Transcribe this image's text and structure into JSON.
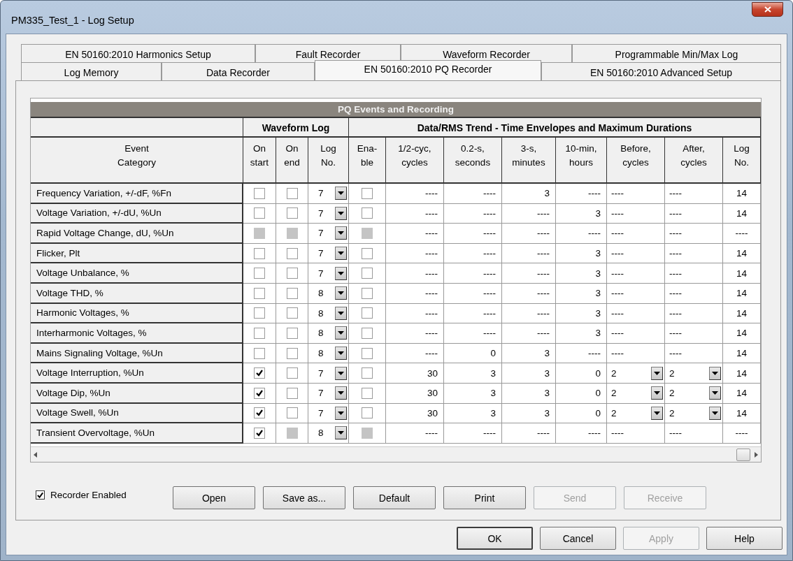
{
  "window": {
    "title": "PM335_Test_1 - Log Setup"
  },
  "tabs": {
    "back_row": [
      {
        "label": "EN 50160:2010 Harmonics Setup",
        "selected": false
      },
      {
        "label": "Fault Recorder",
        "selected": false
      },
      {
        "label": "Waveform Recorder",
        "selected": false
      },
      {
        "label": "Programmable Min/Max Log",
        "selected": false
      }
    ],
    "front_row": [
      {
        "label": "Log Memory",
        "selected": false
      },
      {
        "label": "Data Recorder",
        "selected": false
      },
      {
        "label": "EN 50160:2010 PQ Recorder",
        "selected": true
      },
      {
        "label": "EN 50160:2010 Advanced Setup",
        "selected": false
      }
    ]
  },
  "table": {
    "title": "PQ Events and Recording",
    "groups": [
      "Waveform Log",
      "Data/RMS Trend - Time Envelopes and Maximum Durations"
    ],
    "columns": [
      "Event\nCategory",
      "On\nstart",
      "On\nend",
      "Log\nNo.",
      "Ena-\nble",
      "1/2-cyc,\ncycles",
      "0.2-s,\nseconds",
      "3-s,\nminutes",
      "10-min,\nhours",
      "Before,\ncycles",
      "After,\ncycles",
      "Log\nNo."
    ],
    "rows": [
      {
        "category": "Frequency Variation, +/-dF, %Fn",
        "on_start": {
          "checked": false,
          "disabled": false
        },
        "on_end": {
          "checked": false,
          "disabled": false
        },
        "log_no": "7",
        "enable": {
          "checked": false,
          "disabled": false
        },
        "half_cycle": "----",
        "s02": "----",
        "s3": "3",
        "min10": "----",
        "before": {
          "kind": "text",
          "value": "----"
        },
        "after": {
          "kind": "text",
          "value": "----"
        },
        "trend_log_no": "14"
      },
      {
        "category": "Voltage Variation, +/-dU, %Un",
        "on_start": {
          "checked": false,
          "disabled": false
        },
        "on_end": {
          "checked": false,
          "disabled": false
        },
        "log_no": "7",
        "enable": {
          "checked": false,
          "disabled": false
        },
        "half_cycle": "----",
        "s02": "----",
        "s3": "----",
        "min10": "3",
        "before": {
          "kind": "text",
          "value": "----"
        },
        "after": {
          "kind": "text",
          "value": "----"
        },
        "trend_log_no": "14"
      },
      {
        "category": "Rapid Voltage Change, dU, %Un",
        "on_start": {
          "checked": false,
          "disabled": true
        },
        "on_end": {
          "checked": false,
          "disabled": true
        },
        "log_no": "7",
        "enable": {
          "checked": false,
          "disabled": true
        },
        "half_cycle": "----",
        "s02": "----",
        "s3": "----",
        "min10": "----",
        "before": {
          "kind": "text",
          "value": "----"
        },
        "after": {
          "kind": "text",
          "value": "----"
        },
        "trend_log_no": "----"
      },
      {
        "category": "Flicker, Plt",
        "on_start": {
          "checked": false,
          "disabled": false
        },
        "on_end": {
          "checked": false,
          "disabled": false
        },
        "log_no": "7",
        "enable": {
          "checked": false,
          "disabled": false
        },
        "half_cycle": "----",
        "s02": "----",
        "s3": "----",
        "min10": "3",
        "before": {
          "kind": "text",
          "value": "----"
        },
        "after": {
          "kind": "text",
          "value": "----"
        },
        "trend_log_no": "14"
      },
      {
        "category": "Voltage Unbalance, %",
        "on_start": {
          "checked": false,
          "disabled": false
        },
        "on_end": {
          "checked": false,
          "disabled": false
        },
        "log_no": "7",
        "enable": {
          "checked": false,
          "disabled": false
        },
        "half_cycle": "----",
        "s02": "----",
        "s3": "----",
        "min10": "3",
        "before": {
          "kind": "text",
          "value": "----"
        },
        "after": {
          "kind": "text",
          "value": "----"
        },
        "trend_log_no": "14"
      },
      {
        "category": "Voltage THD, %",
        "on_start": {
          "checked": false,
          "disabled": false
        },
        "on_end": {
          "checked": false,
          "disabled": false
        },
        "log_no": "8",
        "enable": {
          "checked": false,
          "disabled": false
        },
        "half_cycle": "----",
        "s02": "----",
        "s3": "----",
        "min10": "3",
        "before": {
          "kind": "text",
          "value": "----"
        },
        "after": {
          "kind": "text",
          "value": "----"
        },
        "trend_log_no": "14"
      },
      {
        "category": "Harmonic Voltages, %",
        "on_start": {
          "checked": false,
          "disabled": false
        },
        "on_end": {
          "checked": false,
          "disabled": false
        },
        "log_no": "8",
        "enable": {
          "checked": false,
          "disabled": false
        },
        "half_cycle": "----",
        "s02": "----",
        "s3": "----",
        "min10": "3",
        "before": {
          "kind": "text",
          "value": "----"
        },
        "after": {
          "kind": "text",
          "value": "----"
        },
        "trend_log_no": "14"
      },
      {
        "category": "Interharmonic Voltages, %",
        "on_start": {
          "checked": false,
          "disabled": false
        },
        "on_end": {
          "checked": false,
          "disabled": false
        },
        "log_no": "8",
        "enable": {
          "checked": false,
          "disabled": false
        },
        "half_cycle": "----",
        "s02": "----",
        "s3": "----",
        "min10": "3",
        "before": {
          "kind": "text",
          "value": "----"
        },
        "after": {
          "kind": "text",
          "value": "----"
        },
        "trend_log_no": "14"
      },
      {
        "category": "Mains Signaling Voltage, %Un",
        "on_start": {
          "checked": false,
          "disabled": false
        },
        "on_end": {
          "checked": false,
          "disabled": false
        },
        "log_no": "8",
        "enable": {
          "checked": false,
          "disabled": false
        },
        "half_cycle": "----",
        "s02": "0",
        "s3": "3",
        "min10": "----",
        "before": {
          "kind": "text",
          "value": "----"
        },
        "after": {
          "kind": "text",
          "value": "----"
        },
        "trend_log_no": "14"
      },
      {
        "category": "Voltage Interruption, %Un",
        "on_start": {
          "checked": true,
          "disabled": false
        },
        "on_end": {
          "checked": false,
          "disabled": false
        },
        "log_no": "7",
        "enable": {
          "checked": false,
          "disabled": false
        },
        "half_cycle": "30",
        "s02": "3",
        "s3": "3",
        "min10": "0",
        "before": {
          "kind": "dropdown",
          "value": "2"
        },
        "after": {
          "kind": "dropdown",
          "value": "2"
        },
        "trend_log_no": "14"
      },
      {
        "category": "Voltage Dip, %Un",
        "on_start": {
          "checked": true,
          "disabled": false
        },
        "on_end": {
          "checked": false,
          "disabled": false
        },
        "log_no": "7",
        "enable": {
          "checked": false,
          "disabled": false
        },
        "half_cycle": "30",
        "s02": "3",
        "s3": "3",
        "min10": "0",
        "before": {
          "kind": "dropdown",
          "value": "2"
        },
        "after": {
          "kind": "dropdown",
          "value": "2"
        },
        "trend_log_no": "14"
      },
      {
        "category": "Voltage Swell, %Un",
        "on_start": {
          "checked": true,
          "disabled": false
        },
        "on_end": {
          "checked": false,
          "disabled": false
        },
        "log_no": "7",
        "enable": {
          "checked": false,
          "disabled": false
        },
        "half_cycle": "30",
        "s02": "3",
        "s3": "3",
        "min10": "0",
        "before": {
          "kind": "dropdown",
          "value": "2"
        },
        "after": {
          "kind": "dropdown",
          "value": "2"
        },
        "trend_log_no": "14"
      },
      {
        "category": "Transient Overvoltage, %Un",
        "on_start": {
          "checked": true,
          "disabled": false
        },
        "on_end": {
          "checked": false,
          "disabled": true
        },
        "log_no": "8",
        "enable": {
          "checked": false,
          "disabled": true
        },
        "half_cycle": "----",
        "s02": "----",
        "s3": "----",
        "min10": "----",
        "before": {
          "kind": "text",
          "value": "----"
        },
        "after": {
          "kind": "text",
          "value": "----"
        },
        "trend_log_no": "----"
      }
    ]
  },
  "recorder_enabled": {
    "label": "Recorder Enabled",
    "checked": true
  },
  "buttons": [
    {
      "label": "Open",
      "disabled": false
    },
    {
      "label": "Save as...",
      "disabled": false
    },
    {
      "label": "Default",
      "disabled": false
    },
    {
      "label": "Print",
      "disabled": false
    },
    {
      "label": "Send",
      "disabled": true
    },
    {
      "label": "Receive",
      "disabled": true
    }
  ],
  "dialog_buttons": [
    {
      "label": "OK",
      "disabled": false
    },
    {
      "label": "Cancel",
      "disabled": false
    },
    {
      "label": "Apply",
      "disabled": true
    },
    {
      "label": "Help",
      "disabled": false
    }
  ]
}
